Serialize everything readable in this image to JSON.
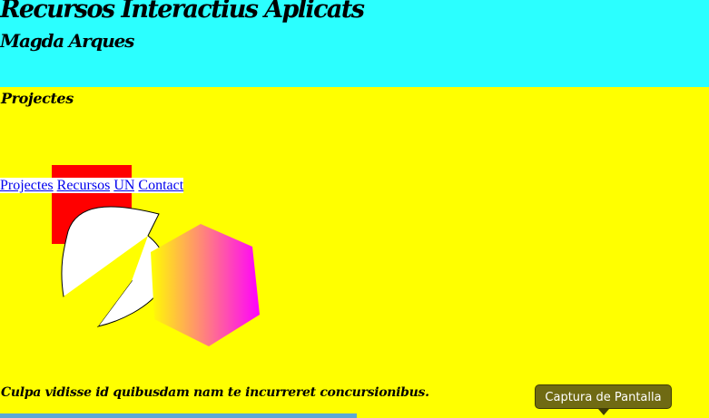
{
  "header": {
    "site_title": "Recursos Interactius Aplicats",
    "subtitle": "Magda Arques",
    "background": "#2bffff"
  },
  "main": {
    "section_title": "Projectes",
    "background": "#ffff00",
    "nav": [
      {
        "label": "Projectes"
      },
      {
        "label": "Recursos"
      },
      {
        "label": "UN"
      },
      {
        "label": "Contact"
      }
    ],
    "tagline": "Culpa vidisse id quibusdam nam te incurreret concursionibus."
  },
  "shapes": {
    "square_color": "#ff0000",
    "leaf_color": "#ffffff",
    "hexagon_gradient": [
      "#ffff00",
      "#ff00ff"
    ]
  },
  "tooltip": {
    "text": "Captura de Pantalla",
    "background": "#6f6a13"
  },
  "bottom_bar": {
    "color": "#5aa8d8"
  }
}
